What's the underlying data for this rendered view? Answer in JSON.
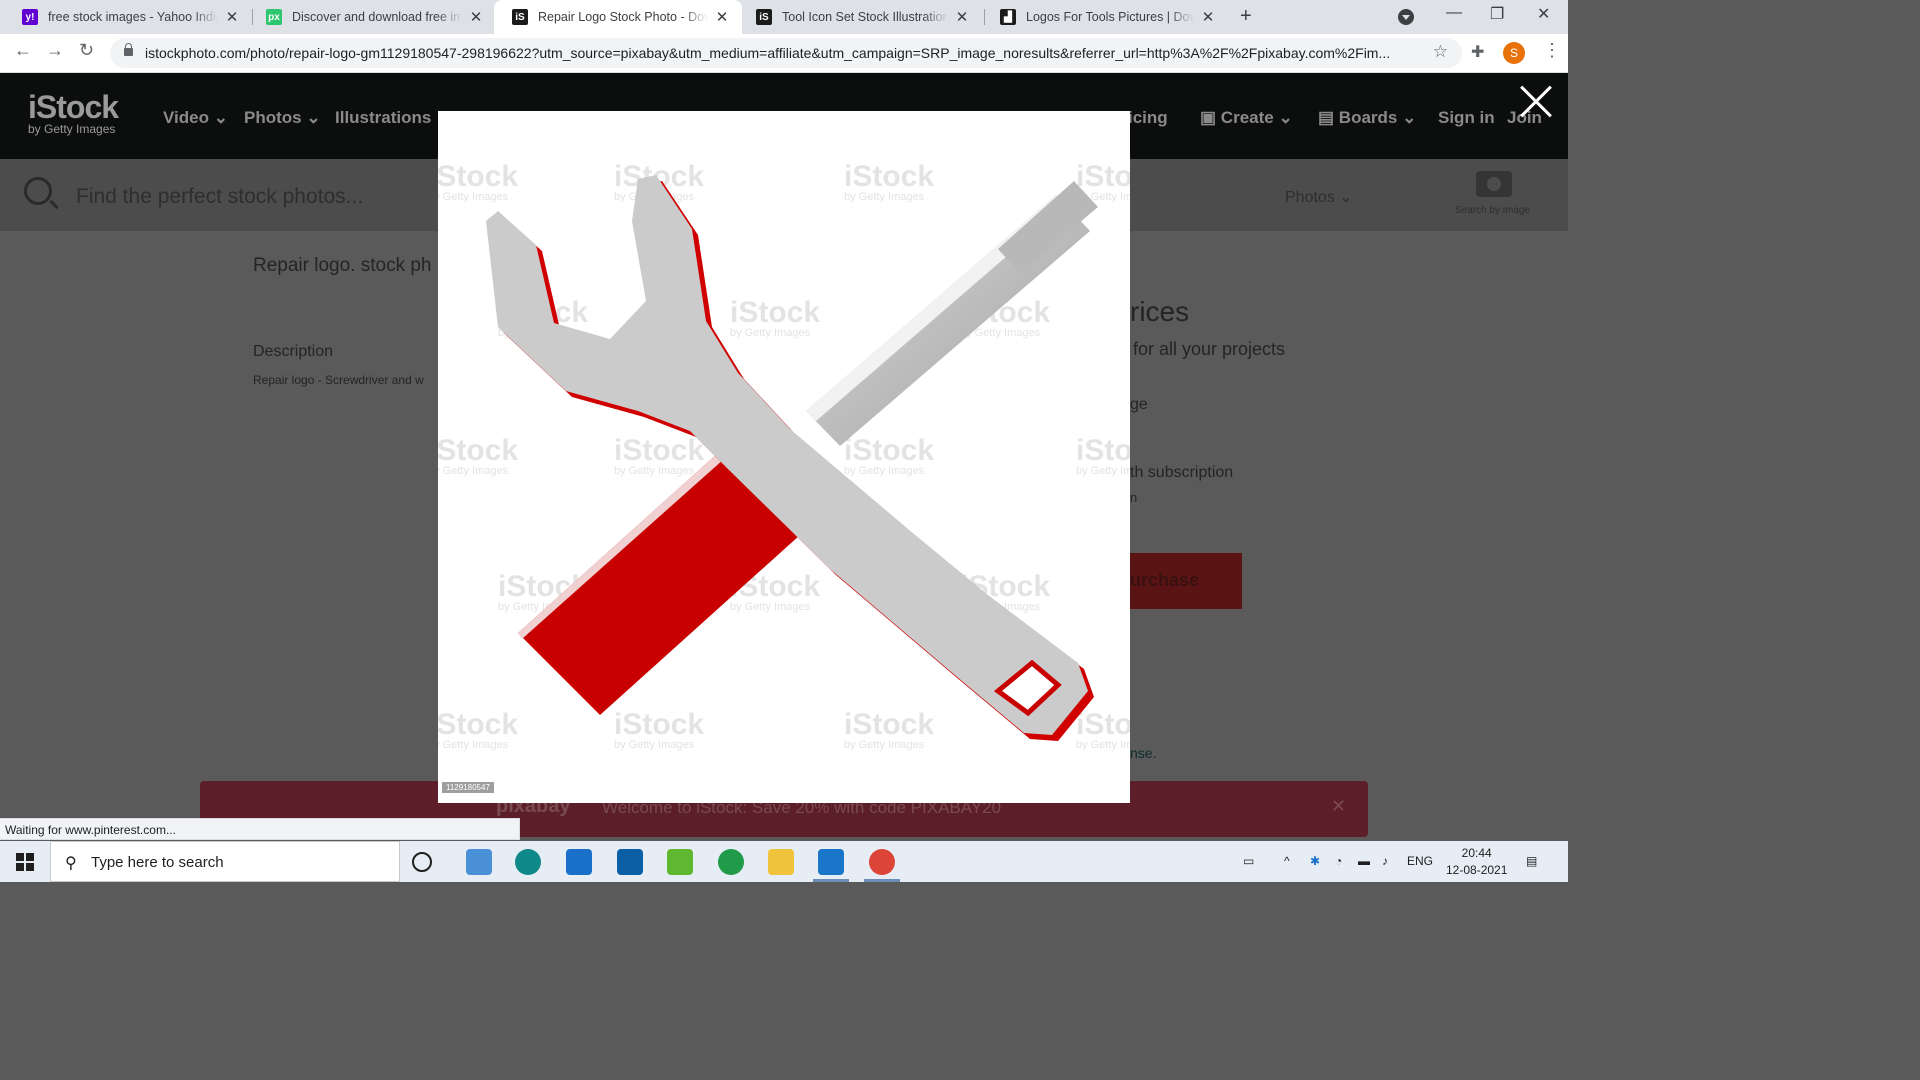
{
  "browser": {
    "tabs": [
      {
        "title": "free stock images - Yahoo India Search Results",
        "favicon": "yahoo-icon",
        "color": "#6001d2",
        "glyph": "y!"
      },
      {
        "title": "Discover and download free images",
        "favicon": "pixabay-icon",
        "color": "#2ec66e",
        "glyph": "px"
      },
      {
        "title": "Repair Logo Stock Photo - Download Image Now",
        "favicon": "istock-icon",
        "color": "#1b1b1b",
        "glyph": "iS",
        "active": true
      },
      {
        "title": "Tool Icon Set Stock Illustration - Download Image",
        "favicon": "istock-icon",
        "color": "#1b1b1b",
        "glyph": "iS"
      },
      {
        "title": "Logos For Tools Pictures | Download Free Images",
        "favicon": "dreamstime-icon",
        "color": "#1b1b1b",
        "glyph": "▟"
      }
    ],
    "new_tab": "+",
    "url": "istockphoto.com/photo/repair-logo-gm1129180547-298196622?utm_source=pixabay&utm_medium=affiliate&utm_campaign=SRP_image_noresults&referrer_url=http%3A%2F%2Fpixabay.com%2Fim...",
    "profile_initial": "S",
    "status_text": "Waiting for www.pinterest.com..."
  },
  "site": {
    "logo": "iStock",
    "logo_sub": "by Getty Images",
    "nav": [
      "Video",
      "Photos",
      "Illustrations"
    ],
    "nav_right": [
      "icing",
      "Create",
      "Boards",
      "Sign in",
      "Join"
    ],
    "search_placeholder": "Find the perfect stock photos...",
    "filter": "Photos",
    "search_by_image": "Search by image",
    "page_title": "Repair logo. stock ph",
    "description_heading": "Description",
    "description": "Repair logo - Screwdriver and w",
    "prices_heading": "rices",
    "prices_sub": "for all your projects",
    "option_image": "ge",
    "option_subscription": "th subscription",
    "option_sub2": "n",
    "purchase": "urchase",
    "license": "nse.",
    "promo_brand": "pixabay",
    "promo_text": "Welcome to iStock: Save 20% with code PIXABAY20"
  },
  "modal": {
    "image_id": "1129180547",
    "watermark": "iStock",
    "watermark_sub": "by Getty Images",
    "colors": {
      "handle": "#c80000",
      "metal": "#c9c9c9"
    }
  },
  "taskbar": {
    "search_placeholder": "Type here to search",
    "language": "ENG",
    "time": "20:44",
    "date": "12-08-2021",
    "apps": [
      "task-view-icon",
      "files-app-icon",
      "edge-icon",
      "mail-icon",
      "dell-icon",
      "bluestacks-icon",
      "whatsapp-icon",
      "file-explorer-icon",
      "vscode-icon",
      "chrome-icon"
    ]
  }
}
